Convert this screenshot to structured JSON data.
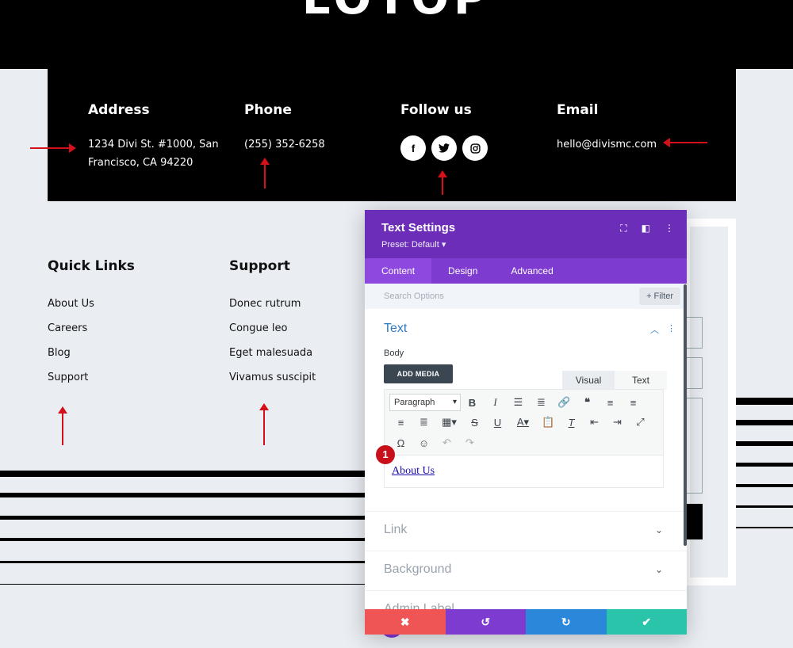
{
  "hero": {
    "title": "LOTOP"
  },
  "contact": {
    "address": {
      "heading": "Address",
      "line1": "1234 Divi St. #1000, San",
      "line2": "Francisco, CA 94220"
    },
    "phone": {
      "heading": "Phone",
      "value": "(255) 352-6258"
    },
    "follow": {
      "heading": "Follow us",
      "icons": [
        "facebook-icon",
        "twitter-icon",
        "instagram-icon"
      ],
      "glyphs": [
        "f",
        "🐦",
        "◎"
      ]
    },
    "email": {
      "heading": "Email",
      "value": "hello@divismc.com"
    }
  },
  "quick_links": {
    "heading": "Quick Links",
    "items": [
      "About Us",
      "Careers",
      "Blog",
      "Support"
    ]
  },
  "support": {
    "heading": "Support",
    "items": [
      "Donec rutrum",
      "Congue leo",
      "Eget malesuada",
      "Vivamus suscipit"
    ]
  },
  "panel": {
    "title": "Text Settings",
    "preset": "Preset: Default ▾",
    "tabs": [
      "Content",
      "Design",
      "Advanced"
    ],
    "search_placeholder": "Search Options",
    "filter_label": "+ Filter",
    "text_section": {
      "title": "Text",
      "body_label": "Body",
      "add_media": "ADD MEDIA",
      "visual_tab": "Visual",
      "text_tab": "Text",
      "format_select": "Paragraph",
      "content_link": "About Us"
    },
    "badge": "1",
    "sections": [
      "Link",
      "Background",
      "Admin Label"
    ]
  },
  "colors": {
    "accent": "#6c2eb9",
    "arrow": "#d4111a",
    "cancel": "#ef5555",
    "undo": "#7e3bd0",
    "redo": "#2b87da",
    "save": "#29c4a9"
  }
}
